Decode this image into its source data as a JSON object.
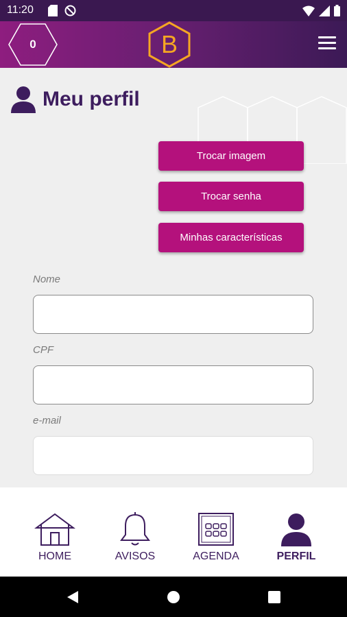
{
  "status_bar": {
    "time": "11:20",
    "left_icons": [
      "sd-card-icon",
      "do-not-disturb-icon"
    ],
    "right_icons": [
      "wifi-icon",
      "signal-icon",
      "battery-icon"
    ]
  },
  "header": {
    "counter_value": "0",
    "logo_letter": "B",
    "menu_icon": "hamburger-menu-icon",
    "colors": {
      "gradient_start": "#8e1d7f",
      "gradient_end": "#3c1a56",
      "logo": "#f5a623"
    }
  },
  "page": {
    "title": "Meu perfil",
    "title_icon": "user-icon"
  },
  "actions": {
    "change_image": "Trocar imagem",
    "change_password": "Trocar senha",
    "my_characteristics": "Minhas características",
    "color": "#b4117c"
  },
  "form": {
    "name_label": "Nome",
    "name_value": "",
    "cpf_label": "CPF",
    "cpf_value": "",
    "email_label": "e-mail",
    "email_value": ""
  },
  "bottom_nav": {
    "items": [
      {
        "label": "HOME",
        "icon": "house-icon",
        "active": false
      },
      {
        "label": "AVISOS",
        "icon": "bell-icon",
        "active": false
      },
      {
        "label": "AGENDA",
        "icon": "calendar-icon",
        "active": false
      },
      {
        "label": "PERFIL",
        "icon": "user-icon",
        "active": true
      }
    ]
  },
  "system_nav": {
    "icons": [
      "back-icon",
      "home-circle-icon",
      "recents-icon"
    ]
  }
}
